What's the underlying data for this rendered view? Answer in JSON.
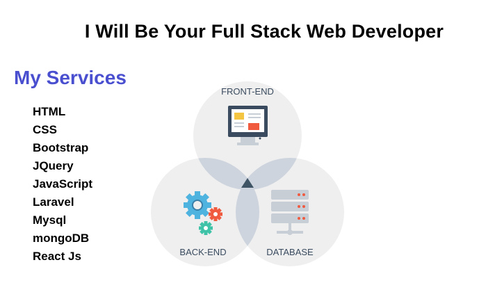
{
  "header": {
    "title": "I Will Be Your Full Stack Web Developer"
  },
  "services": {
    "heading": "My Services",
    "items": [
      "HTML",
      "CSS",
      "Bootstrap",
      "JQuery",
      "JavaScript",
      "Laravel",
      "Mysql",
      "mongoDB",
      "React Js"
    ]
  },
  "diagram": {
    "front_label": "FRONT-END",
    "back_label": "BACK-END",
    "db_label": "DATABASE",
    "colors": {
      "circle": "#efefef",
      "overlap": "#cdd4dd",
      "center": "#3f5566",
      "monitor_blue": "#3a4b5f",
      "yellow": "#f4c542",
      "red": "#f05a3e",
      "cyan": "#4fb3e0",
      "green": "#3fc3a8",
      "server": "#c8ced6"
    }
  }
}
